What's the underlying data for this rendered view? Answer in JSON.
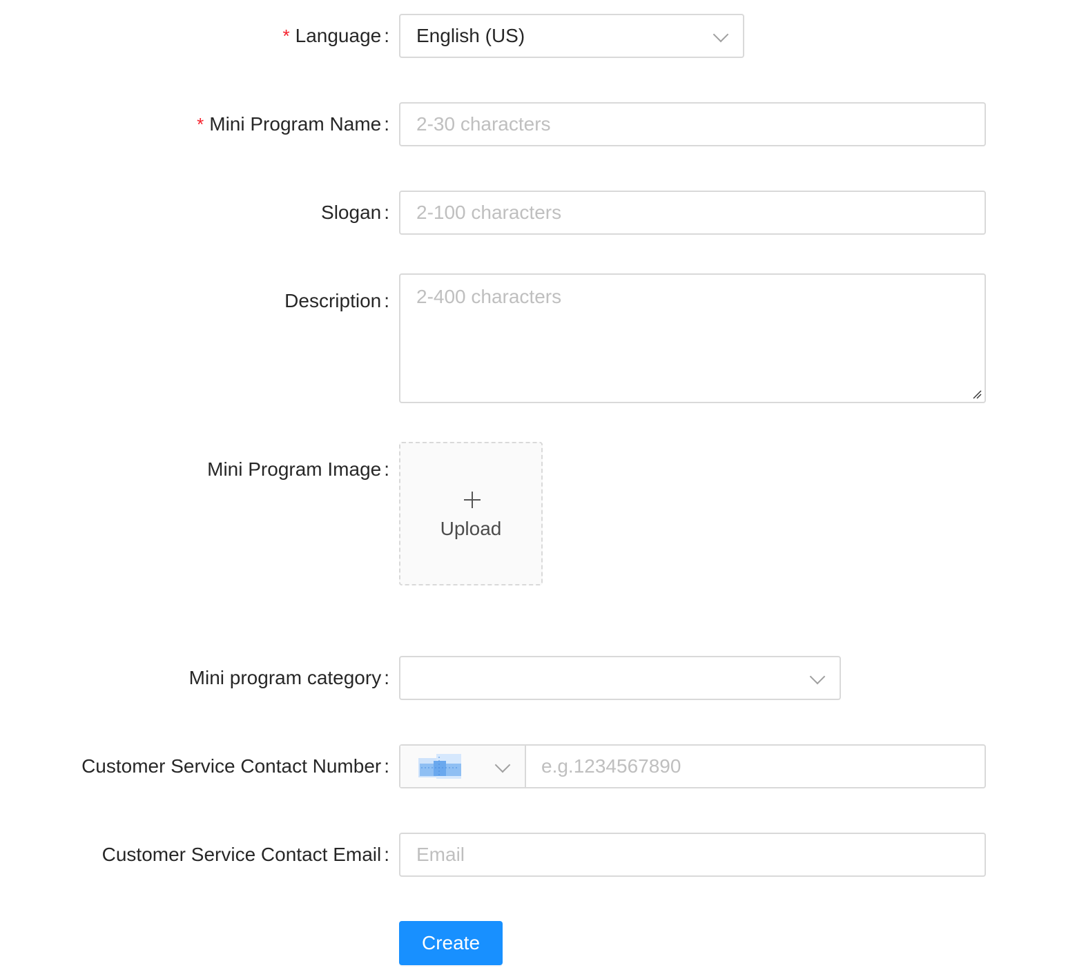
{
  "form": {
    "language": {
      "label": "Language",
      "required_mark": "*",
      "value": "English (US)"
    },
    "name": {
      "label": "Mini Program Name",
      "required_mark": "*",
      "placeholder": "2-30 characters"
    },
    "slogan": {
      "label": "Slogan",
      "placeholder": "2-100 characters"
    },
    "description": {
      "label": "Description",
      "placeholder": "2-400 characters"
    },
    "image": {
      "label": "Mini Program Image",
      "upload_text": "Upload"
    },
    "category": {
      "label": "Mini program category",
      "value": ""
    },
    "phone": {
      "label": "Customer Service Contact Number",
      "placeholder": "e.g.1234567890"
    },
    "email": {
      "label": "Customer Service Contact Email",
      "placeholder": "Email"
    },
    "colon": ":",
    "submit_label": "Create"
  },
  "colors": {
    "primary": "#1890ff",
    "required": "#f5222d",
    "border": "#d9d9d9",
    "placeholder": "#bfbfbf"
  },
  "icons": {
    "select_arrow": "chevron-down-icon",
    "upload": "plus-icon",
    "country": "flag-icon"
  }
}
